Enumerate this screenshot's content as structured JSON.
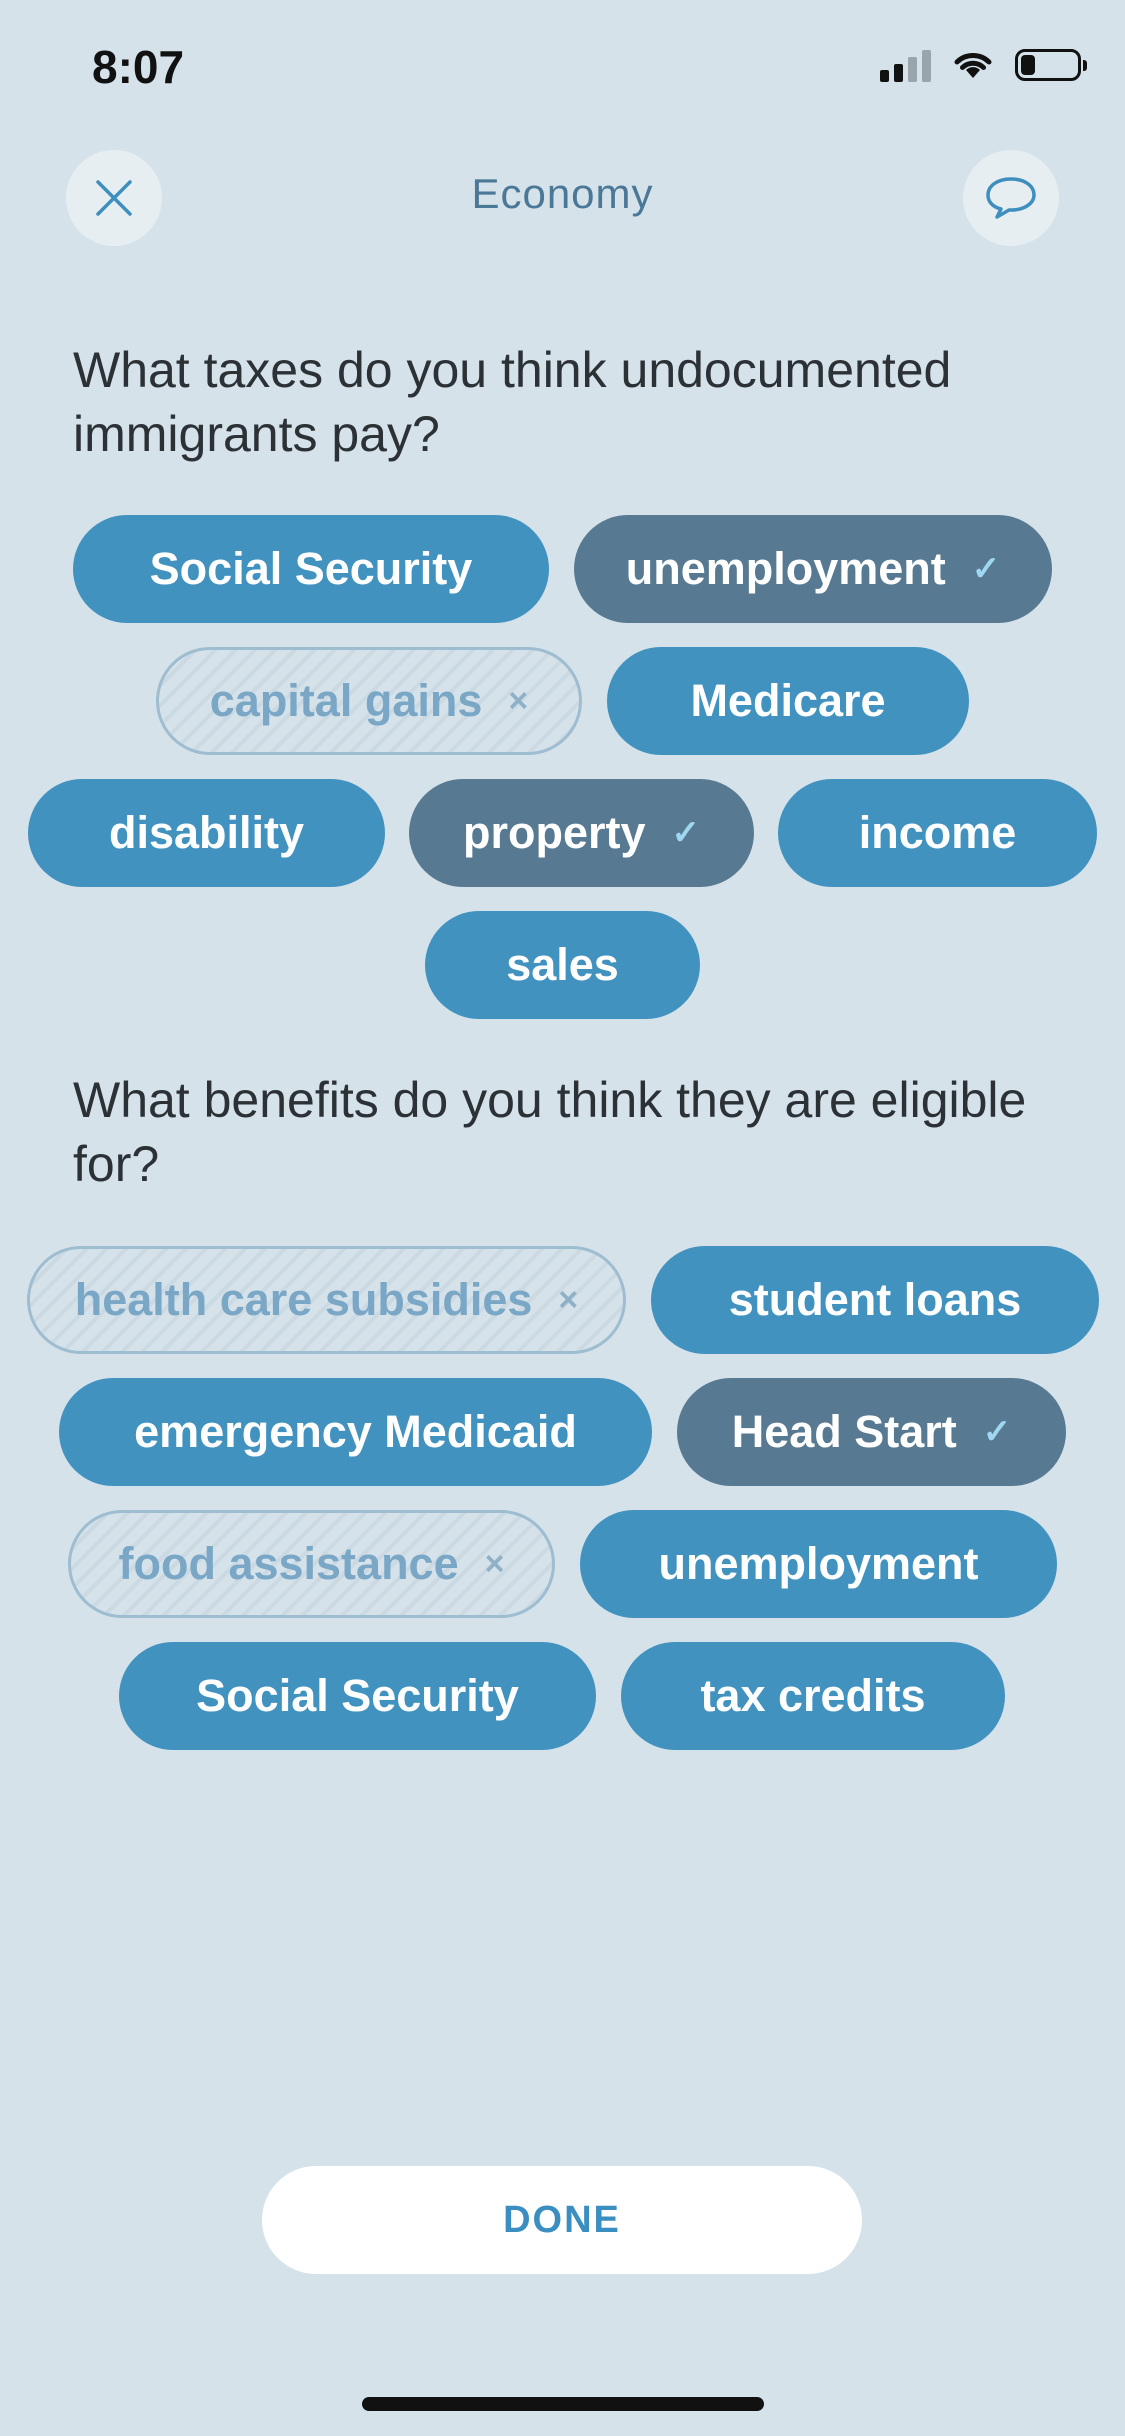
{
  "status_bar": {
    "time": "8:07"
  },
  "header": {
    "title": "Economy",
    "close_icon": "close-icon",
    "chat_icon": "chat-bubble-icon"
  },
  "questions": [
    {
      "text": "What taxes do you think undocumented immigrants pay?",
      "options": [
        {
          "label": "Social Security",
          "state": "default"
        },
        {
          "label": "unemployment",
          "state": "selected"
        },
        {
          "label": "capital gains",
          "state": "rejected"
        },
        {
          "label": "Medicare",
          "state": "default"
        },
        {
          "label": "disability",
          "state": "default"
        },
        {
          "label": "property",
          "state": "selected"
        },
        {
          "label": "income",
          "state": "default"
        },
        {
          "label": "sales",
          "state": "default"
        }
      ]
    },
    {
      "text": "What benefits do you think they are eligible for?",
      "options": [
        {
          "label": "health care subsidies",
          "state": "rejected"
        },
        {
          "label": "student loans",
          "state": "default"
        },
        {
          "label": "emergency Medicaid",
          "state": "default"
        },
        {
          "label": "Head Start",
          "state": "selected"
        },
        {
          "label": "food assistance",
          "state": "rejected"
        },
        {
          "label": "unemployment",
          "state": "default"
        },
        {
          "label": "Social Security",
          "state": "default"
        },
        {
          "label": "tax credits",
          "state": "default"
        }
      ]
    }
  ],
  "marks": {
    "selected": "✓",
    "rejected": "×"
  },
  "done_label": "DONE",
  "colors": {
    "background": "#d5e2ea",
    "chip_default": "#4292c0",
    "chip_selected": "#577991",
    "chip_rejected_text": "#7aa7c6",
    "accent": "#3b8fc0"
  }
}
